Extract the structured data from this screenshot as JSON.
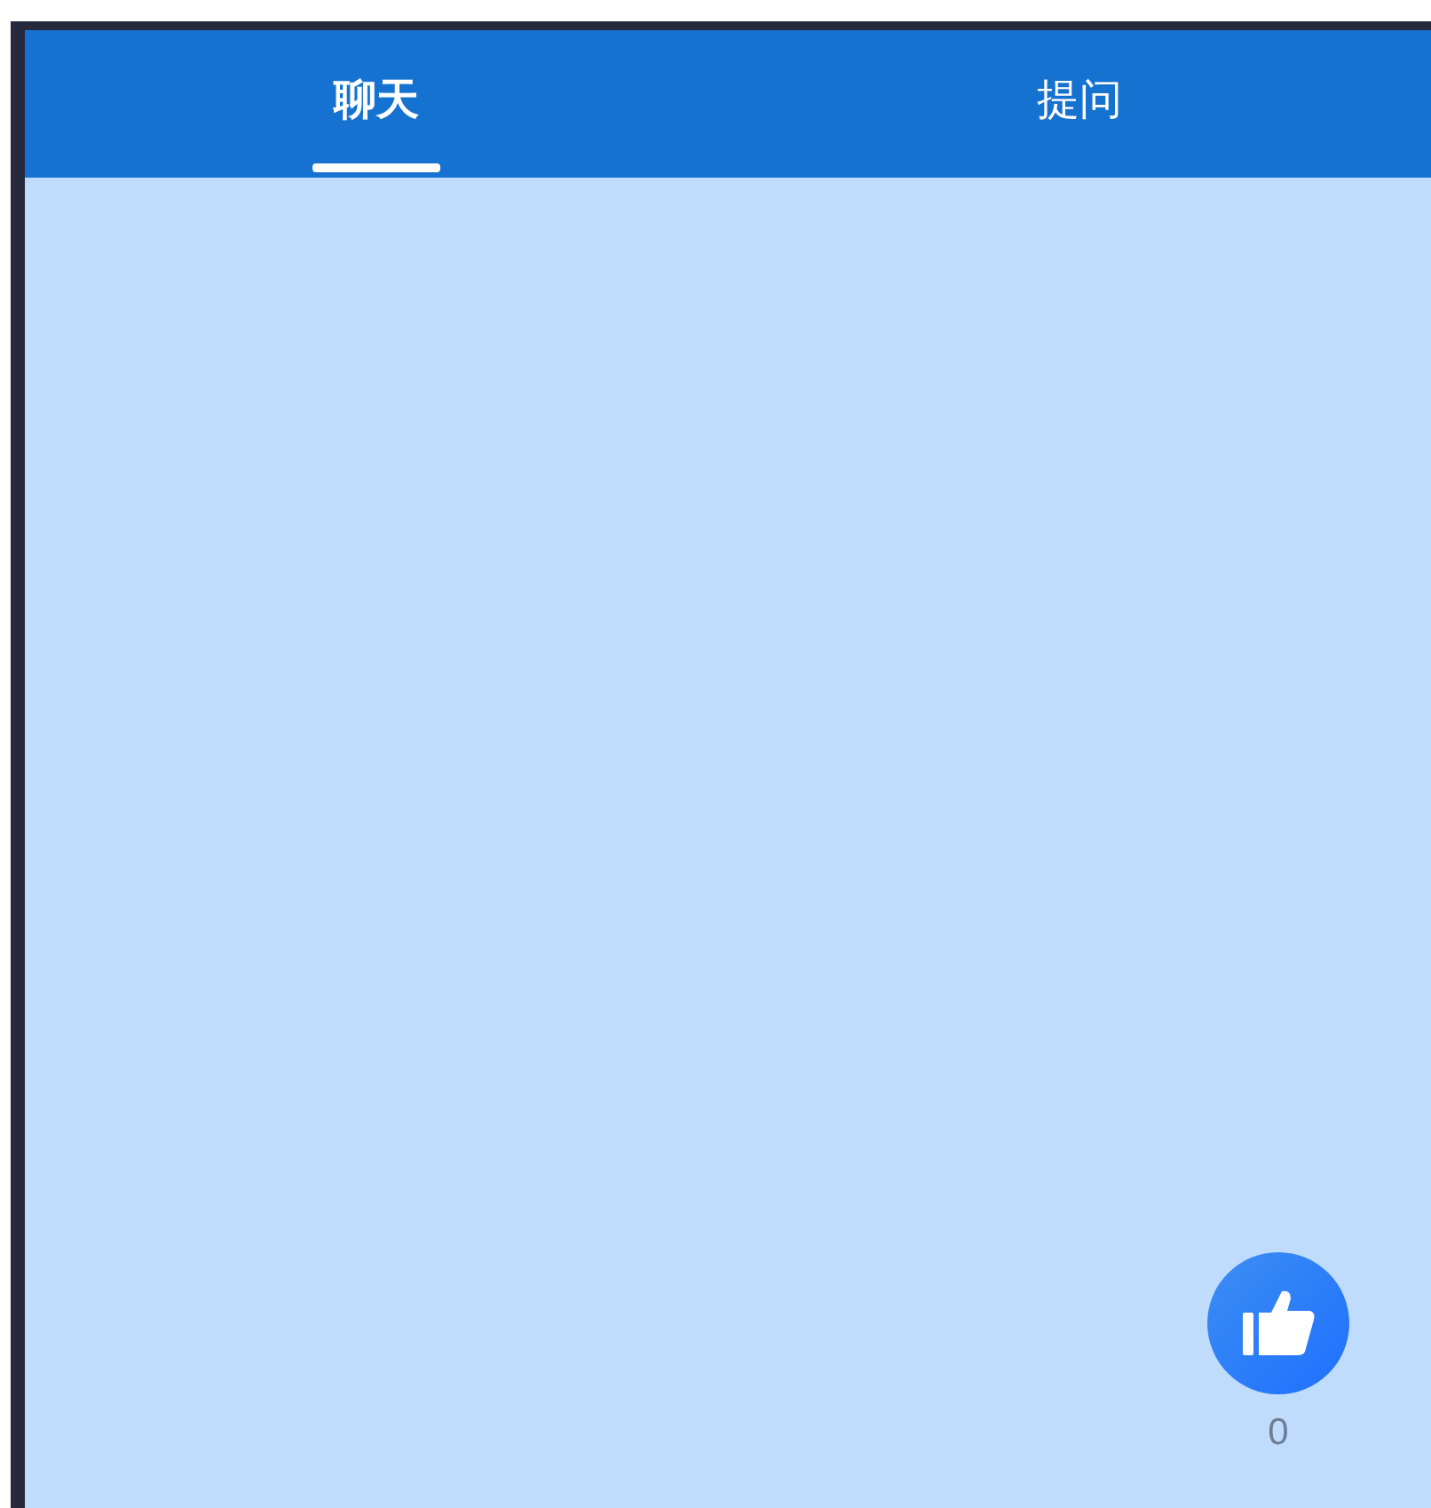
{
  "tabs": [
    {
      "label": "聊天",
      "selected": true
    },
    {
      "label": "提问",
      "selected": false
    }
  ],
  "like": {
    "count": "0"
  }
}
